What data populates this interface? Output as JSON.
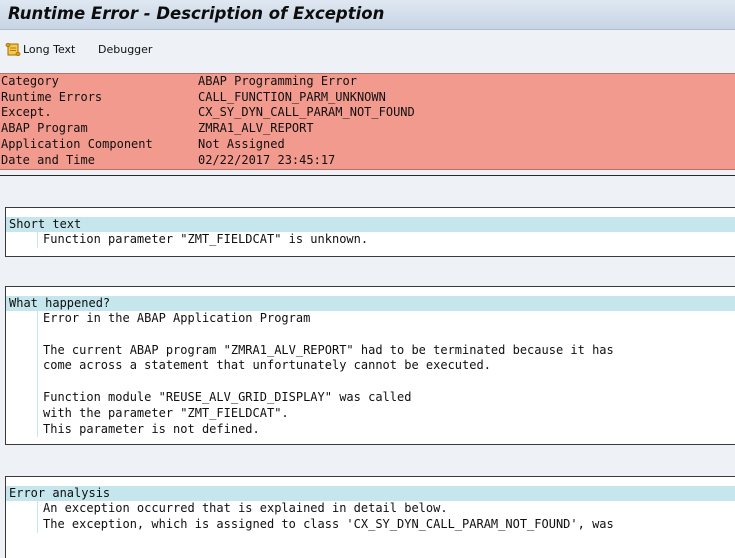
{
  "window": {
    "title": "Runtime Error - Description of Exception"
  },
  "toolbar": {
    "long_text": "Long Text",
    "debugger": "Debugger"
  },
  "header": {
    "rows": [
      {
        "key": "Category",
        "value": "ABAP Programming Error"
      },
      {
        "key": "Runtime Errors",
        "value": "CALL_FUNCTION_PARM_UNKNOWN"
      },
      {
        "key": "Except.",
        "value": "CX_SY_DYN_CALL_PARAM_NOT_FOUND"
      },
      {
        "key": "ABAP Program",
        "value": "ZMRA1_ALV_REPORT"
      },
      {
        "key": "Application Component",
        "value": "Not Assigned"
      },
      {
        "key": "Date and Time",
        "value": "02/22/2017 23:45:17"
      }
    ]
  },
  "sections": {
    "short_text": {
      "title": "Short text",
      "lines": [
        "Function parameter \"ZMT_FIELDCAT\" is unknown."
      ]
    },
    "what_happened": {
      "title": "What happened?",
      "lines": [
        "Error in the ABAP Application Program",
        "",
        "The current ABAP program \"ZMRA1_ALV_REPORT\" had to be terminated because it has",
        "come across a statement that unfortunately cannot be executed.",
        "",
        "Function module \"REUSE_ALV_GRID_DISPLAY\" was called",
        "with the parameter \"ZMT_FIELDCAT\".",
        "This parameter is not defined."
      ]
    },
    "error_analysis": {
      "title": "Error analysis",
      "lines": [
        "An exception occurred that is explained in detail below.",
        "The exception, which is assigned to class 'CX_SY_DYN_CALL_PARAM_NOT_FOUND', was"
      ]
    }
  }
}
